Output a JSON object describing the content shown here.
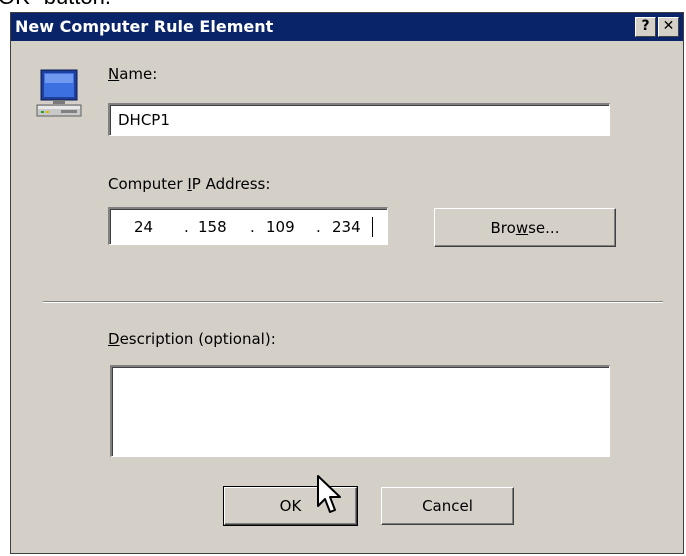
{
  "background_snippet": "OK\" button.",
  "dialog": {
    "title": "New Computer Rule Element",
    "help_button": "?",
    "close_button": "✕"
  },
  "name_section": {
    "label_accel": "N",
    "label_rest": "ame:",
    "value": "DHCP1"
  },
  "ip_section": {
    "label_pre": "Computer ",
    "label_accel": "I",
    "label_rest": "P Address:",
    "octets": [
      "24",
      "158",
      "109",
      "234"
    ],
    "dot": "."
  },
  "browse_button": {
    "pre": "Bro",
    "accel": "w",
    "post": "se..."
  },
  "description_section": {
    "label_accel": "D",
    "label_rest": "escription (optional):",
    "value": ""
  },
  "buttons": {
    "ok": "OK",
    "cancel": "Cancel"
  },
  "colors": {
    "title_bar": "#0a246a",
    "dialog_face": "#d4d0c8",
    "field_bg": "#ffffff"
  },
  "icons": [
    "computer-icon",
    "help-icon",
    "close-icon",
    "mouse-pointer-icon"
  ]
}
